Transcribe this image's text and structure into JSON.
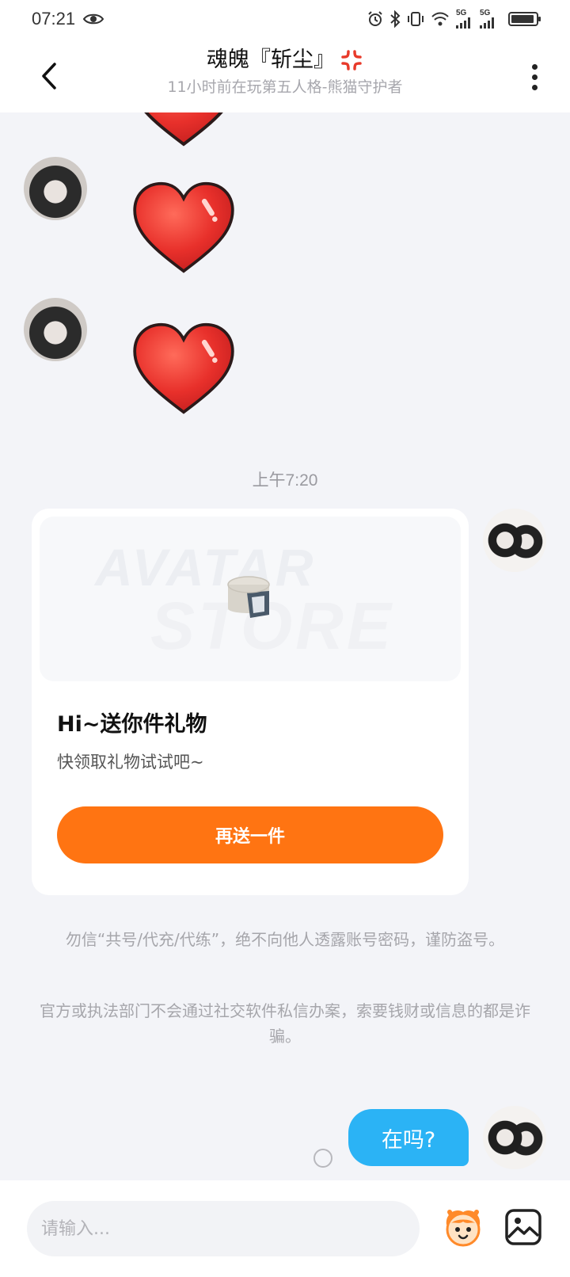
{
  "status_bar": {
    "time": "07:21",
    "network_1": "5G",
    "network_2": "5G"
  },
  "header": {
    "title": "魂魄『斩尘』",
    "subtitle": "11小时前在玩第五人格-熊猫守护者"
  },
  "chat": {
    "timestamp": "上午7:20",
    "gift_card": {
      "watermark_line1": "AVATAR",
      "watermark_line2": "STORE",
      "title": "Hi~送你件礼物",
      "description": "快领取礼物试试吧~",
      "button_label": "再送一件"
    },
    "notices": [
      "勿信“共号/代充/代练”，绝不向他人透露账号密码，谨防盗号。",
      "官方或执法部门不会通过社交软件私信办案，索要钱财或信息的都是诈骗。"
    ],
    "sent_message": "在吗?"
  },
  "input_bar": {
    "placeholder": "请输入..."
  },
  "colors": {
    "accent_orange": "#ff7412",
    "bubble_blue": "#2bb3f5",
    "heart_red": "#e8302b",
    "background": "#f3f4f8"
  },
  "icons": [
    "eye-icon",
    "alarm-icon",
    "bluetooth-icon",
    "vibrate-icon",
    "wifi-icon",
    "signal-icon",
    "battery-icon",
    "back-arrow-icon",
    "anger-emoji-icon",
    "more-vertical-icon",
    "heart-emoji-icon",
    "sticker-icon",
    "image-icon"
  ]
}
